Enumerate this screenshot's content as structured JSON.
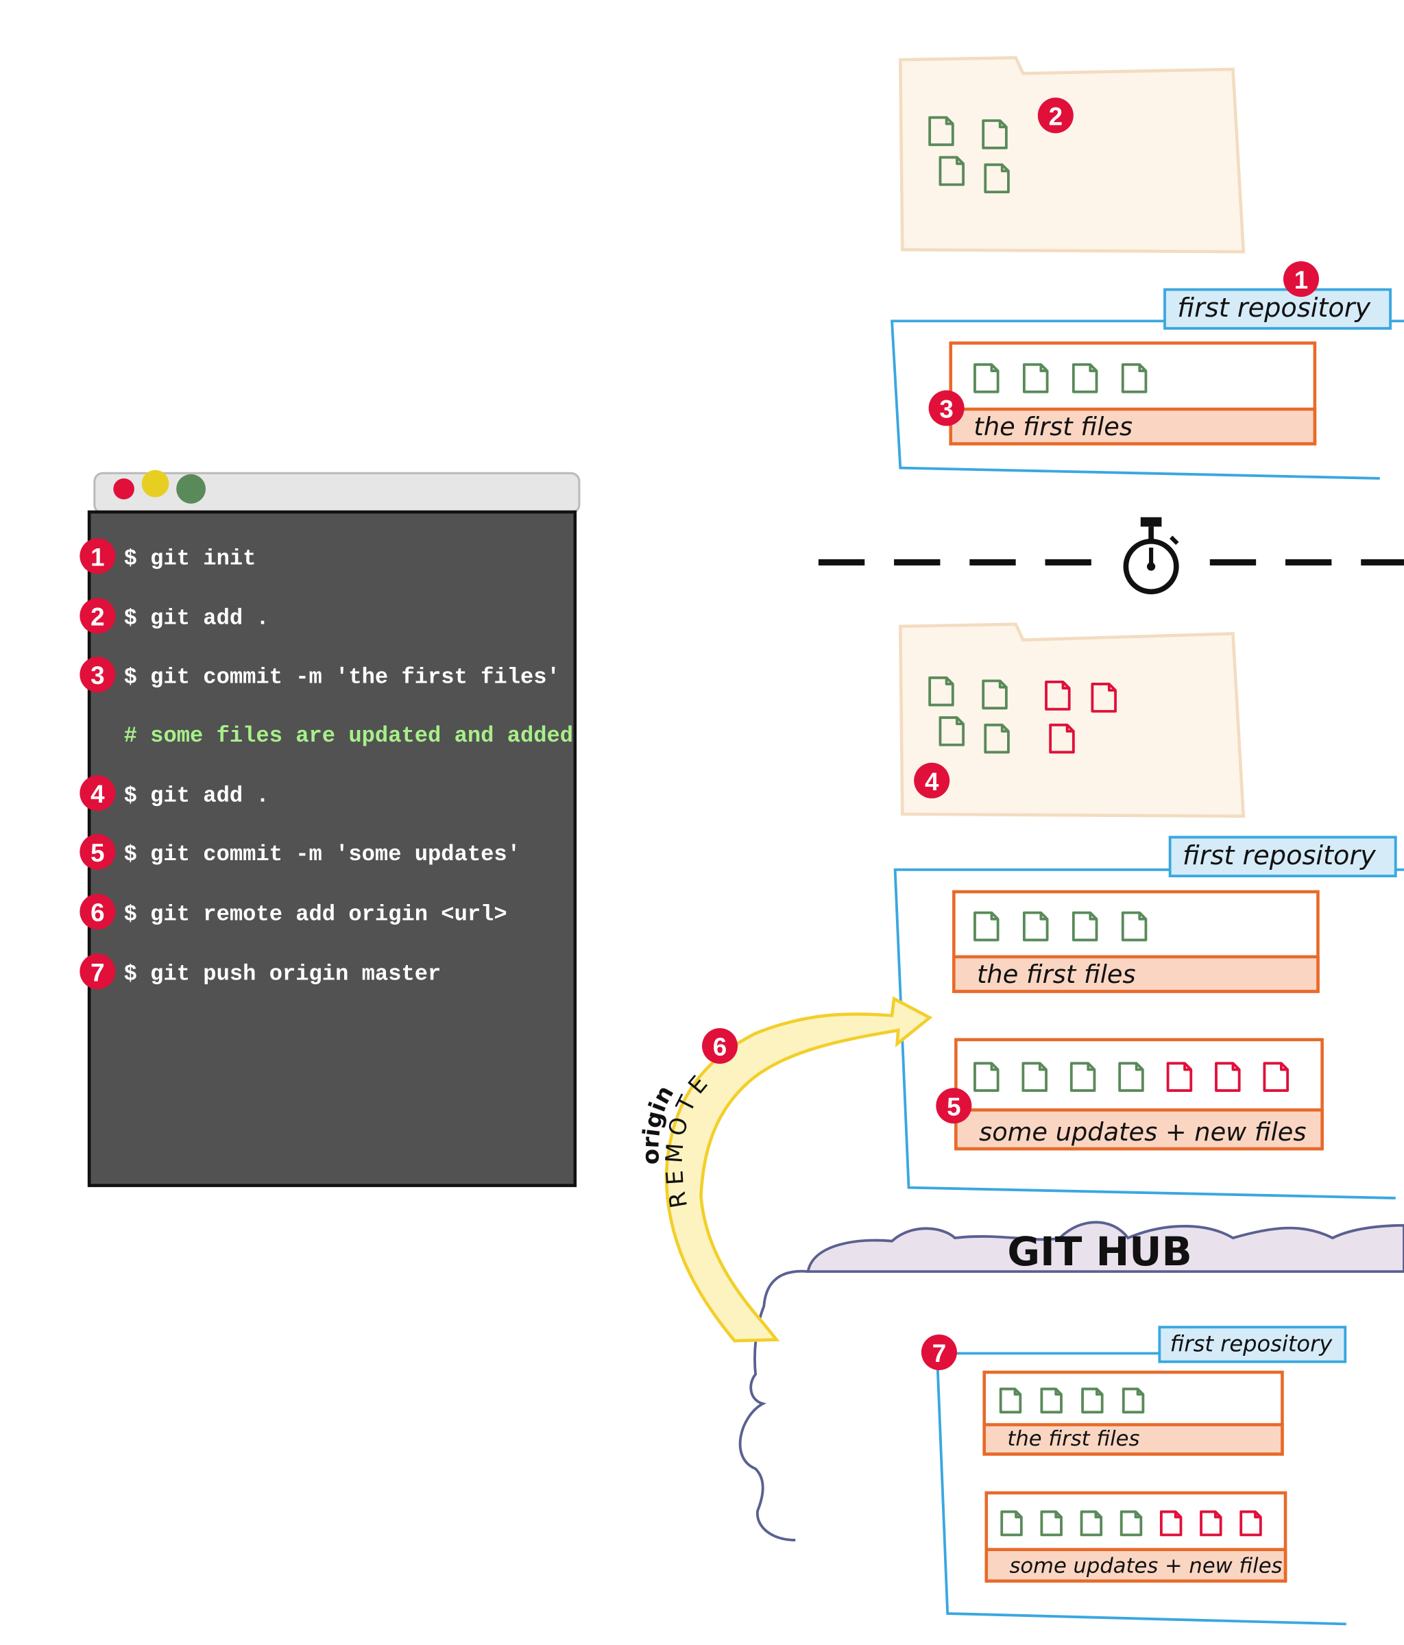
{
  "colors": {
    "badge": "#e0103a",
    "terminal_bg": "#525252",
    "terminal_bar": "#e6e6e6",
    "command": "#ffffff",
    "comment": "#a8ef8a",
    "file_tracked": "#5a8a5a",
    "file_new": "#e0103a",
    "repo_outline": "#3aa7e0",
    "repo_tab": "#d5ebf8",
    "commit_outline": "#e86a2a",
    "commit_band": "#fad6c2",
    "folder_fill": "#fdf5ea",
    "folder_stroke": "#f3dcc0",
    "cloud_fill": "#e9e1ec",
    "cloud_stroke": "#5a6090",
    "arrow_fill": "#fdf3c0",
    "arrow_stroke": "#f2cf2a"
  },
  "terminal": {
    "window_buttons": [
      "close",
      "minimize",
      "maximize"
    ],
    "lines": [
      {
        "badge": "1",
        "text": "$ git init",
        "type": "command"
      },
      {
        "badge": "2",
        "text": "$ git add .",
        "type": "command"
      },
      {
        "badge": "3",
        "text": "$ git commit -m 'the first files'",
        "type": "command"
      },
      {
        "badge": "",
        "text": "# some files are updated and added",
        "type": "comment"
      },
      {
        "badge": "4",
        "text": "$ git add .",
        "type": "command"
      },
      {
        "badge": "5",
        "text": "$ git commit -m 'some updates'",
        "type": "command"
      },
      {
        "badge": "6",
        "text": "$ git remote add origin <url>",
        "type": "command"
      },
      {
        "badge": "7",
        "text": "$ git push origin master",
        "type": "command"
      }
    ]
  },
  "working_dir_1": {
    "badge": "2",
    "files": {
      "tracked": 4,
      "new": 0
    }
  },
  "repo_1": {
    "badge": "1",
    "label": "first repository",
    "commits": [
      {
        "badge": "3",
        "message": "the first files",
        "files": {
          "tracked": 4,
          "new": 0
        }
      }
    ]
  },
  "timeline_icon": "stopwatch-icon",
  "working_dir_2": {
    "badge": "4",
    "files": {
      "tracked": 4,
      "new": 3
    }
  },
  "repo_2": {
    "label": "first repository",
    "commits": [
      {
        "message": "the first files",
        "files": {
          "tracked": 4,
          "new": 0
        }
      },
      {
        "badge": "5",
        "message": "some updates + new files",
        "files": {
          "tracked": 4,
          "new": 3
        }
      }
    ]
  },
  "remote_arrow": {
    "badge": "6",
    "label": "REMOTE",
    "sublabel": "origin"
  },
  "github": {
    "title": "GIT HUB",
    "repo": {
      "badge": "7",
      "label": "first repository",
      "commits": [
        {
          "message": "the first files",
          "files": {
            "tracked": 4,
            "new": 0
          }
        },
        {
          "message": "some updates + new files",
          "files": {
            "tracked": 4,
            "new": 3
          }
        }
      ]
    }
  }
}
